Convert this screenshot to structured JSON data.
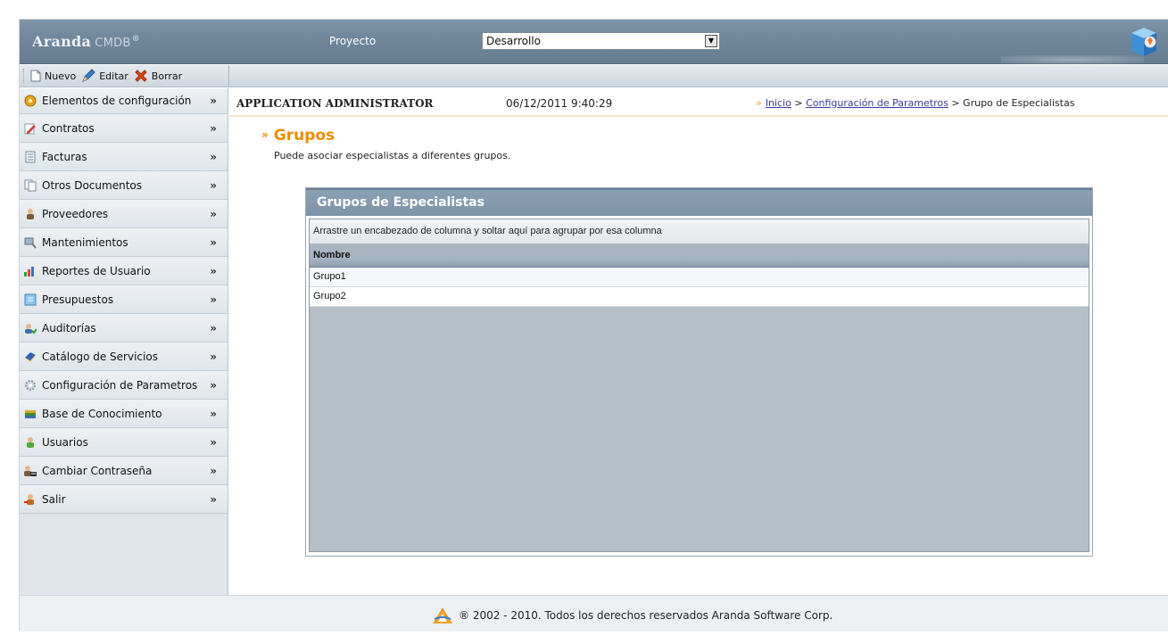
{
  "header": {
    "logo_main": "Aranda",
    "logo_sub": "CMDB",
    "logo_reg": "®",
    "project_label": "Proyecto",
    "project_value": "Desarrollo"
  },
  "toolbar": {
    "new_label": "Nuevo",
    "edit_label": "Editar",
    "delete_label": "Borrar"
  },
  "sidebar": {
    "items": [
      {
        "label": "Elementos de configuración",
        "icon": "config-items-icon"
      },
      {
        "label": "Contratos",
        "icon": "contract-icon"
      },
      {
        "label": "Facturas",
        "icon": "invoice-icon"
      },
      {
        "label": "Otros Documentos",
        "icon": "documents-icon"
      },
      {
        "label": "Proveedores",
        "icon": "suppliers-icon"
      },
      {
        "label": "Mantenimientos",
        "icon": "maintenance-icon"
      },
      {
        "label": "Reportes de Usuario",
        "icon": "reports-icon"
      },
      {
        "label": "Presupuestos",
        "icon": "budget-icon"
      },
      {
        "label": "Auditorías",
        "icon": "audit-icon"
      },
      {
        "label": "Catálogo de Servicios",
        "icon": "service-catalog-icon"
      },
      {
        "label": "Configuración de Parametros",
        "icon": "settings-gear-icon"
      },
      {
        "label": "Base de Conocimiento",
        "icon": "knowledge-base-icon"
      },
      {
        "label": "Usuarios",
        "icon": "users-icon"
      },
      {
        "label": "Cambiar Contraseña",
        "icon": "change-password-icon"
      },
      {
        "label": "Salir",
        "icon": "logout-icon"
      }
    ]
  },
  "infobar": {
    "user": "APPLICATION ADMINISTRATOR",
    "datetime": "06/12/2011 9:40:29",
    "breadcrumb_home": "Inicio",
    "breadcrumb_sep": ">",
    "breadcrumb_config": "Configuración de Parametros",
    "breadcrumb_current": "Grupo de Especialistas"
  },
  "page": {
    "title": "Grupos",
    "description": "Puede asociar especialistas a diferentes grupos."
  },
  "panel": {
    "title": "Grupos de Especialistas",
    "group_hint": "Arrastre un encabezado de columna y soltar aquí para agrupar por esa columna",
    "column_name": "Nombre",
    "rows": [
      "Grupo1",
      "Grupo2"
    ]
  },
  "footer": {
    "copyright": "® 2002 - 2010. Todos los derechos reservados Aranda Software Corp."
  },
  "colors": {
    "accent_orange": "#f08a00",
    "header_blue": "#6e859a",
    "link_purple": "#3b3b9a"
  }
}
